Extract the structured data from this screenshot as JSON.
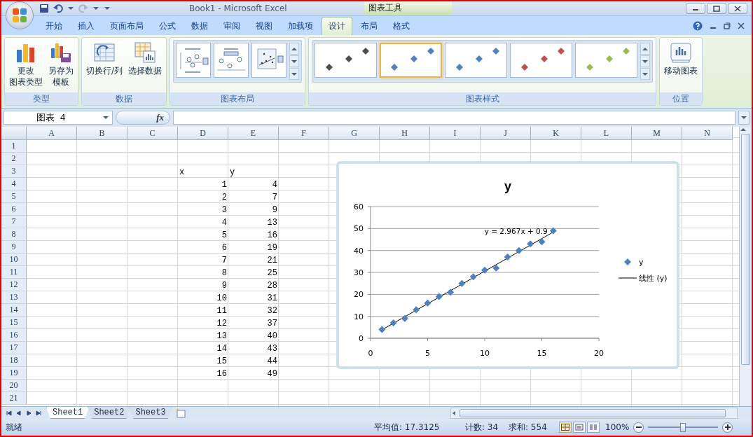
{
  "window": {
    "title": "Book1  -  Microsoft Excel",
    "context_title": "图表工具"
  },
  "ribbon_tabs": [
    {
      "label": "开始",
      "selected": false
    },
    {
      "label": "插入",
      "selected": false
    },
    {
      "label": "页面布局",
      "selected": false
    },
    {
      "label": "公式",
      "selected": false
    },
    {
      "label": "数据",
      "selected": false
    },
    {
      "label": "审阅",
      "selected": false
    },
    {
      "label": "视图",
      "selected": false
    },
    {
      "label": "加载项",
      "selected": false
    },
    {
      "label": "设计",
      "selected": true
    },
    {
      "label": "布局",
      "selected": false
    },
    {
      "label": "格式",
      "selected": false
    }
  ],
  "ribbon_groups": [
    {
      "kind": "buttons",
      "title": "类型",
      "buttons": [
        {
          "kind": "change_type",
          "lines": [
            "更改",
            "图表类型"
          ]
        },
        {
          "kind": "save_template",
          "lines": [
            "另存为",
            "模板"
          ]
        }
      ]
    },
    {
      "kind": "buttons",
      "title": "数据",
      "buttons": [
        {
          "kind": "switch",
          "lines": [
            "切换行/列"
          ]
        },
        {
          "kind": "select_data",
          "lines": [
            "选择数据"
          ]
        }
      ]
    },
    {
      "kind": "layouts",
      "title": "图表布局",
      "layouts": [
        {
          "kind": "legend"
        },
        {
          "kind": "labels"
        },
        {
          "kind": "scatter"
        }
      ]
    },
    {
      "kind": "styles",
      "title": "图表样式",
      "styles": [
        {
          "color": "#4d4d4d",
          "selected": false
        },
        {
          "color": "#4f81bd",
          "selected": true
        },
        {
          "color": "#4f81bd",
          "selected": false
        },
        {
          "color": "#c0504d",
          "selected": false
        },
        {
          "color": "#9bbb59",
          "selected": false
        }
      ]
    },
    {
      "kind": "buttons",
      "title": "位置",
      "buttons": [
        {
          "kind": "move",
          "lines": [
            "移动图表"
          ]
        }
      ]
    }
  ],
  "formula_bar": {
    "name_box": "图表 4",
    "function_label": "fx"
  },
  "columns": [
    "A",
    "B",
    "C",
    "D",
    "E",
    "F",
    "G",
    "H",
    "I",
    "J",
    "K",
    "L",
    "M",
    "N"
  ],
  "rows": [
    {
      "number": "1"
    },
    {
      "number": "2"
    },
    {
      "number": "3",
      "column_d": "x",
      "column_e": "y"
    },
    {
      "number": "4",
      "column_d": "1",
      "column_e": "4"
    },
    {
      "number": "5",
      "column_d": "2",
      "column_e": "7"
    },
    {
      "number": "6",
      "column_d": "3",
      "column_e": "9"
    },
    {
      "number": "7",
      "column_d": "4",
      "column_e": "13"
    },
    {
      "number": "8",
      "column_d": "5",
      "column_e": "16"
    },
    {
      "number": "9",
      "column_d": "6",
      "column_e": "19"
    },
    {
      "number": "10",
      "column_d": "7",
      "column_e": "21"
    },
    {
      "number": "11",
      "column_d": "8",
      "column_e": "25"
    },
    {
      "number": "12",
      "column_d": "9",
      "column_e": "28"
    },
    {
      "number": "13",
      "column_d": "10",
      "column_e": "31"
    },
    {
      "number": "14",
      "column_d": "11",
      "column_e": "32"
    },
    {
      "number": "15",
      "column_d": "12",
      "column_e": "37"
    },
    {
      "number": "16",
      "column_d": "13",
      "column_e": "40"
    },
    {
      "number": "17",
      "column_d": "14",
      "column_e": "43"
    },
    {
      "number": "18",
      "column_d": "15",
      "column_e": "44"
    },
    {
      "number": "19",
      "column_d": "16",
      "column_e": "49"
    },
    {
      "number": "20"
    },
    {
      "number": "21"
    }
  ],
  "chart": {
    "legend": [
      {
        "kind": "line",
        "label": "线性 (y)"
      }
    ],
    "chart_data": {
      "type": "scatter",
      "title": "y",
      "x": [
        1,
        2,
        3,
        4,
        5,
        6,
        7,
        8,
        9,
        10,
        11,
        12,
        13,
        14,
        15,
        16
      ],
      "series": [
        {
          "name": "y",
          "color": "#4f81bd",
          "values": [
            4,
            7,
            9,
            13,
            16,
            19,
            21,
            25,
            28,
            31,
            32,
            37,
            40,
            43,
            44,
            49
          ]
        }
      ],
      "xlim": [
        0,
        20
      ],
      "ylim": [
        0,
        60
      ],
      "xticks": [
        0,
        5,
        10,
        15,
        20
      ],
      "yticks": [
        0,
        10,
        20,
        30,
        40,
        50,
        60
      ],
      "grid": true,
      "annotations": [
        {
          "text": "y = 2.967x + 0.9"
        }
      ]
    }
  },
  "sheet_tabs": [
    {
      "label": "Sheet1",
      "selected": true
    },
    {
      "label": "Sheet2",
      "selected": false
    },
    {
      "label": "Sheet3",
      "selected": false
    }
  ],
  "status_bar": {
    "status": "就绪",
    "average": "平均值: 17.3125",
    "count": "计数: 34",
    "sum": "求和: 554",
    "zoom": "100%",
    "zoom_slider": {
      "level": 0.5
    }
  }
}
